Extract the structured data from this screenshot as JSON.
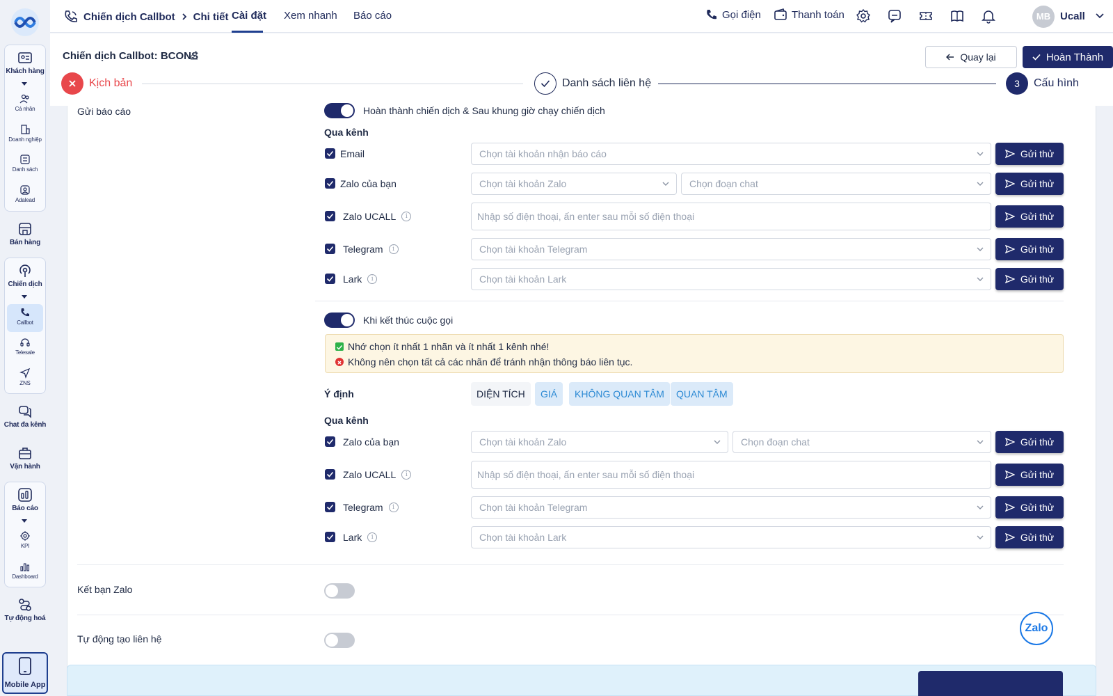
{
  "sidebar": {
    "groups": {
      "customers": {
        "label": "Khách hàng",
        "items": [
          "Cá nhân",
          "Doanh nghiệp",
          "Danh sách",
          "Adalead"
        ]
      },
      "sales": {
        "label": "Bán hàng"
      },
      "campaign": {
        "label": "Chiến dịch",
        "items": [
          "Callbot",
          "Telesale",
          "ZNS"
        ]
      },
      "omnichat": {
        "label": "Chat đa kênh"
      },
      "operations": {
        "label": "Vận hành"
      },
      "reports": {
        "label": "Báo cáo",
        "items": [
          "KPI",
          "Dashboard"
        ]
      },
      "automation": {
        "label": "Tự động hoá"
      },
      "mobile": {
        "label": "Mobile App"
      }
    }
  },
  "topbar": {
    "breadcrumb": [
      "Chiến dịch Callbot",
      "Chi tiết"
    ],
    "tabs": [
      "Cài đặt",
      "Xem nhanh",
      "Báo cáo"
    ],
    "call_label": "Gọi điện",
    "payment_label": "Thanh toán",
    "avatar_initials": "MB",
    "username": "Ucall"
  },
  "header": {
    "title": "Chiến dịch Callbot: BCONS",
    "back_label": "Quay lại",
    "done_label": "Hoàn Thành",
    "steps": [
      {
        "label": "Kịch bản",
        "state": "error"
      },
      {
        "label": "Danh sách liên hệ",
        "state": "done"
      },
      {
        "label": "Cấu hình",
        "state": "active",
        "number": "3"
      }
    ]
  },
  "report": {
    "label": "Gửi báo cáo",
    "toggle1_label": "Hoàn thành chiến dịch & Sau khung giờ chạy chiến dịch",
    "channels_heading": "Qua kênh",
    "send_label": "Gửi thử",
    "channels": [
      {
        "name": "Email",
        "placeholder": "Chọn tài khoản nhận báo cáo"
      },
      {
        "name": "Zalo của bạn",
        "placeholder": "Chọn tài khoản Zalo",
        "placeholder2": "Chọn đoạn chat"
      },
      {
        "name": "Zalo UCALL",
        "placeholder": "Nhập số điện thoại, ấn enter sau mỗi số điện thoại"
      },
      {
        "name": "Telegram",
        "placeholder": "Chọn tài khoản Telegram"
      },
      {
        "name": "Lark",
        "placeholder": "Chọn tài khoản Lark"
      }
    ],
    "toggle2_label": "Khi kết thúc cuộc gọi",
    "alert": {
      "tip_ok": "Nhớ chọn ít nhất 1 nhãn và ít nhất 1 kênh nhé!",
      "tip_warn": "Không nên chọn tất cả các nhãn để tránh nhận thông báo liên tục."
    },
    "intent_label": "Ý định",
    "intent_tags": [
      "DIỆN TÍCH",
      "GIÁ",
      "KHÔNG QUAN TÂM",
      "QUAN TÂM"
    ],
    "channels_heading2": "Qua kênh",
    "channels2": [
      {
        "name": "Zalo của bạn",
        "placeholder": "Chọn tài khoản Zalo",
        "placeholder2": "Chọn đoạn chat"
      },
      {
        "name": "Zalo UCALL",
        "placeholder": "Nhập số điện thoại, ấn enter sau mỗi số điện thoại"
      },
      {
        "name": "Telegram",
        "placeholder": "Chọn tài khoản Telegram"
      },
      {
        "name": "Lark",
        "placeholder": "Chọn tài khoản Lark"
      }
    ]
  },
  "zalo_friend": {
    "label": "Kết bạn Zalo"
  },
  "auto_contact": {
    "label": "Tự động tạo liên hệ"
  },
  "zalo_badge": "Zalo",
  "colors": {
    "primary": "#1f2a6b",
    "error": "#e8474b",
    "tag_blue": "#2d8ad4",
    "alert_bg": "#fdf6e3"
  }
}
